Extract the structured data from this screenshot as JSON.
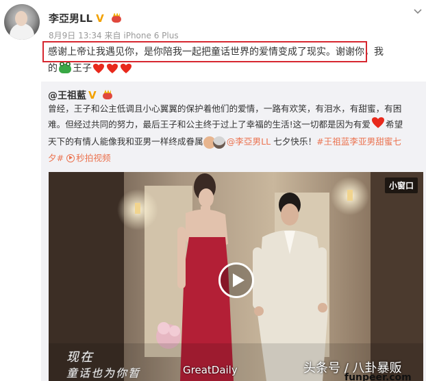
{
  "post": {
    "user_name": "李亞男LL",
    "date": "8月9日",
    "time": "13:34",
    "via_label": "来自",
    "device": "iPhone 6 Plus",
    "text_line1": "感谢上帝让我遇见你，是你陪我一起把童话世界的爱情变成了现实。谢谢你，我",
    "text_line2_a": "的",
    "text_line2_b": "王子"
  },
  "repost": {
    "author": "@王祖藍",
    "text_rows": [
      "曾经，王子和公主低调且小心翼翼的保护着他们的爱情，一路有欢笑，有泪水，有甜蜜，有困",
      "难。但经过共同的努力，最后王子和公主终于过上了幸福的生活!这一切都是因为有爱"
    ],
    "row3_a": "希望",
    "row4_a": "天下的有情人能像我和亚男一样终成眷属",
    "mention": "@李亞男LL",
    "row4_b": " 七夕快乐！",
    "topic_a": "#王祖蓝李亚男甜蜜七",
    "topic_b": "夕#",
    "video_link": "秒拍视频"
  },
  "video": {
    "small_window_label": "小窗口",
    "subtitle_1": "现在",
    "subtitle_2": "童话也为你暂",
    "watermark_1": "GreatDaily",
    "watermark_2": "头条号 / 八卦暴贩",
    "watermark_3": "funpeer.com"
  },
  "colors": {
    "highlight_border": "#d6262e",
    "link": "#eb7350",
    "repost_bg": "#f2f2f5"
  }
}
